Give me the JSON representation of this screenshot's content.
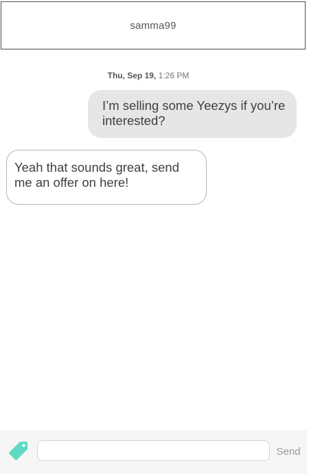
{
  "header": {
    "title": "samma99"
  },
  "conversation": {
    "timestamp_date": "Thu, Sep 19,",
    "timestamp_time": "1:26 PM",
    "messages": [
      {
        "direction": "outgoing",
        "text": "I’m selling some Yeezys if you’re interested?"
      },
      {
        "direction": "incoming",
        "text": "Yeah that sounds great, send me an offer on here!"
      }
    ]
  },
  "composer": {
    "tag_icon": "price-tag-icon",
    "input_value": "",
    "input_placeholder": "",
    "send_label": "Send"
  },
  "colors": {
    "tag_accent": "#5fd9c2",
    "outgoing_bubble": "#e6e6e6",
    "incoming_border": "#b5b5b5",
    "footer_background": "#f6f6f6"
  }
}
